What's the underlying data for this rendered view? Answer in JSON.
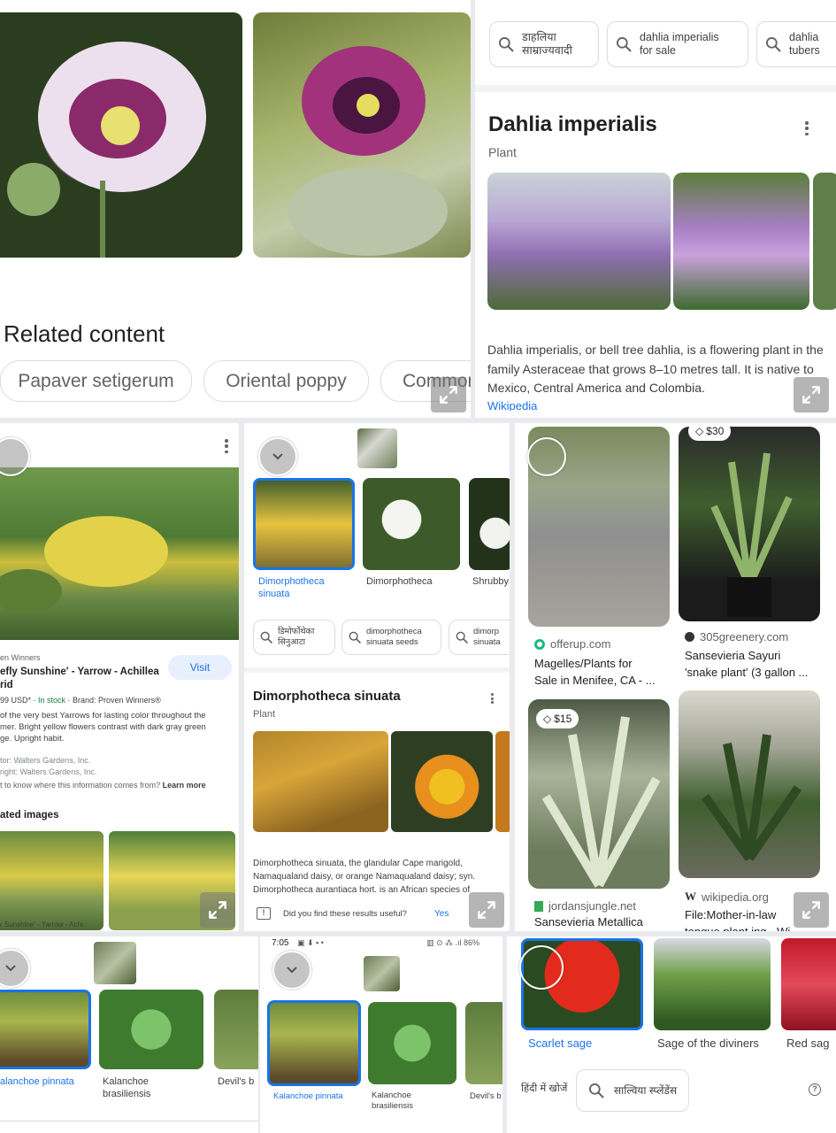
{
  "tile_poppy": {
    "heading": "Related content",
    "chips": [
      "Papaver setigerum",
      "Oriental poppy",
      "Common"
    ]
  },
  "tile_dahlia": {
    "searches": [
      {
        "l1": "डाहलिया",
        "l2": "साम्राज्यवादी"
      },
      {
        "l1": "dahlia imperialis",
        "l2": "for sale"
      },
      {
        "l1": "dahlia",
        "l2": "tubers"
      }
    ],
    "title": "Dahlia imperialis",
    "subtitle": "Plant",
    "description": "Dahlia imperialis, or bell tree dahlia, is a flowering plant in the family Asteraceae that grows 8–10 metres tall. It is native to Mexico, Central America and Colombia.",
    "source": "Wikipedia"
  },
  "tile_yarrow": {
    "seller": "en Winners",
    "visit": "Visit",
    "title_l1": "efly Sunshine' - Yarrow - Achillea",
    "title_l2": "rid",
    "price": "99 USD*",
    "stock": "In stock",
    "brand": "Brand: Proven Winners®",
    "desc_l1": "of the very best Yarrows for lasting color throughout the",
    "desc_l2": "mer. Bright yellow flowers contrast with dark gray green",
    "desc_l3": "ge. Upright habit.",
    "credit_l1": "tor: Walters Gardens, Inc.",
    "credit_l2": "right: Walters Gardens, Inc.",
    "learn_q": "t to know where this information comes from?",
    "learn_more": "Learn more",
    "related": "ated images",
    "caption": "r Sunshine' - Yarrow - Achi..."
  },
  "tile_dimor": {
    "thumbs": [
      {
        "l1": "Dimorphotheca",
        "l2": "sinuata"
      },
      {
        "l1": "Dimorphotheca",
        "l2": ""
      },
      {
        "l1": "Shrubby",
        "l2": ""
      }
    ],
    "searches": [
      {
        "l1": "डिमोर्फोथेका",
        "l2": "सिनुआटा"
      },
      {
        "l1": "dimorphotheca",
        "l2": "sinuata seeds"
      },
      {
        "l1": "dimorp",
        "l2": "sinuata"
      }
    ],
    "title": "Dimorphotheca sinuata",
    "subtitle": "Plant",
    "description": "Dimorphotheca sinuata, the glandular Cape marigold, Namaqualand daisy, or orange Namaqualand daisy; syn. Dimorphotheca aurantiaca hort. is an African species of",
    "feedback": "Did you find these results useful?",
    "yes": "Yes"
  },
  "tile_sansevieria": {
    "items": [
      {
        "source": "offerup.com",
        "l1": "Magelles/Plants for",
        "l2": "Sale in Menifee, CA - ..."
      },
      {
        "source": "305greenery.com",
        "l1": "Sansevieria Sayuri",
        "l2": "'snake plant' (3 gallon ..."
      },
      {
        "source": "jordansjungle.net",
        "l1": "Sansevieria Metallica",
        "l2": ""
      },
      {
        "source": "wikipedia.org",
        "l1": "File:Mother-in-law",
        "l2": "tongue plant ing - Wi"
      }
    ],
    "price1": "$30",
    "price2": "$15"
  },
  "tile_kal1": {
    "thumbs": [
      {
        "l1": "alanchoe pinnata",
        "l2": ""
      },
      {
        "l1": "Kalanchoe",
        "l2": "brasiliensis"
      },
      {
        "l1": "Devil's b",
        "l2": ""
      }
    ]
  },
  "tile_kal2": {
    "status_time": "7:05",
    "status_right": "86%",
    "thumbs": [
      {
        "l1": "Kalanchoe pinnata",
        "l2": ""
      },
      {
        "l1": "Kalanchoe",
        "l2": "brasiliensis"
      },
      {
        "l1": "Devil's b",
        "l2": ""
      }
    ]
  },
  "tile_sage": {
    "thumbs": [
      {
        "l1": "Scarlet sage"
      },
      {
        "l1": "Sage of the diviners"
      },
      {
        "l1": "Red sag"
      }
    ],
    "hindi_link": "हिंदी में खोजें",
    "search_chip": "साल्विया स्प्लेंडेंस"
  },
  "icons": {
    "search": "search-icon",
    "expand": "expand-icon",
    "more": "more-vert-icon",
    "help": "help-icon",
    "tag": "price-tag-icon"
  },
  "colors": {
    "link": "#1a73e8",
    "stock": "#188038",
    "bg": "#e9eaed"
  }
}
